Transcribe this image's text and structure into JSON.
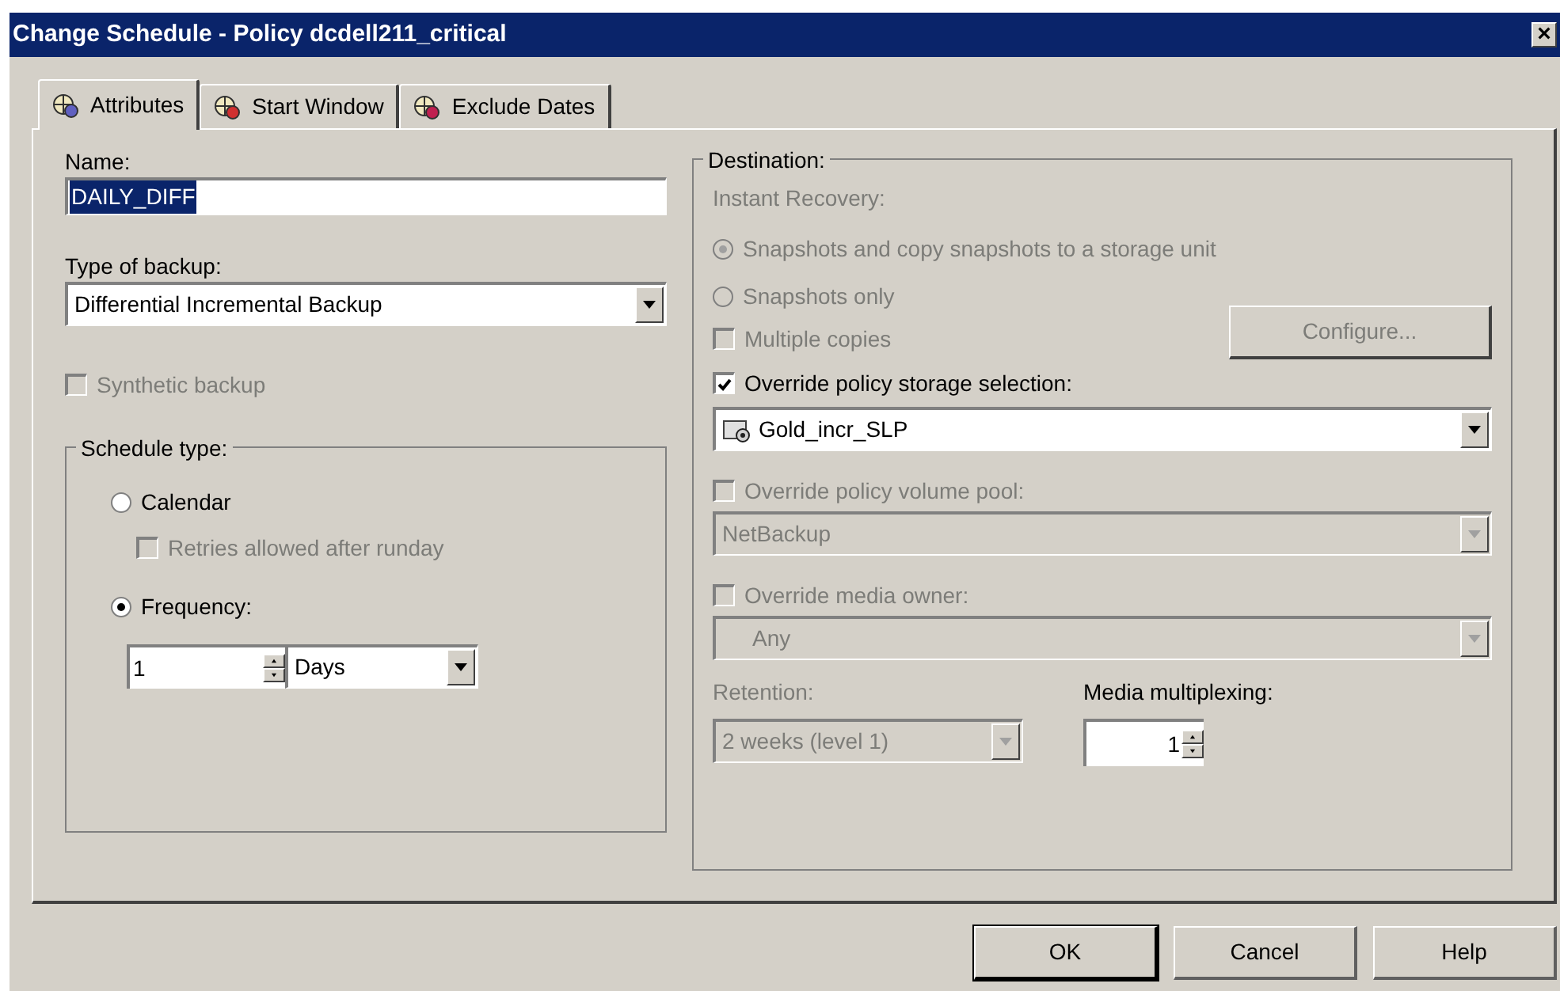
{
  "window": {
    "title": "Change Schedule - Policy dcdell211_critical",
    "close": "×"
  },
  "tabs": [
    {
      "label": "Attributes",
      "selected": true
    },
    {
      "label": "Start Window",
      "selected": false
    },
    {
      "label": "Exclude Dates",
      "selected": false
    }
  ],
  "name": {
    "label": "Name:",
    "value": "DAILY_DIFF"
  },
  "backup_type": {
    "label": "Type of backup:",
    "value": "Differential Incremental Backup",
    "disabled": false
  },
  "synthetic_backup": {
    "label": "Synthetic backup",
    "checked": false,
    "disabled": true
  },
  "schedule_type": {
    "title": "Schedule type:",
    "calendar": {
      "label": "Calendar",
      "selected": false,
      "disabled": false
    },
    "retries": {
      "label": "Retries allowed after runday",
      "checked": false,
      "disabled": true
    },
    "frequency": {
      "label": "Frequency:",
      "selected": true,
      "disabled": false
    },
    "frequency_value": "1",
    "frequency_unit": "Days"
  },
  "destination": {
    "title": "Destination:",
    "instant_recovery": "Instant Recovery:",
    "snapshot_options": [
      {
        "label": "Snapshots and copy snapshots to a storage unit",
        "selected": true,
        "disabled": true
      },
      {
        "label": "Snapshots only",
        "selected": false,
        "disabled": true
      }
    ],
    "multiple_copies": {
      "label": "Multiple copies",
      "checked": false,
      "disabled": true
    },
    "configure_button": {
      "label": "Configure...",
      "disabled": true
    },
    "override_storage": {
      "label": "Override policy storage selection:",
      "checked": true,
      "disabled": false
    },
    "storage": {
      "value": "Gold_incr_SLP",
      "disabled": false
    },
    "override_pool": {
      "label": "Override policy volume pool:",
      "checked": false,
      "disabled": true
    },
    "pool": {
      "value": "NetBackup",
      "disabled": true
    },
    "override_owner": {
      "label": "Override media owner:",
      "checked": false,
      "disabled": true
    },
    "owner": {
      "value": "Any",
      "disabled": true
    },
    "retention": {
      "label": "Retention:",
      "value": "2 weeks (level 1)",
      "disabled": true
    },
    "multiplexing": {
      "label": "Media multiplexing:",
      "value": "1"
    }
  },
  "buttons": [
    {
      "label": "OK",
      "default": true
    },
    {
      "label": "Cancel",
      "default": false
    },
    {
      "label": "Help",
      "default": false
    }
  ]
}
